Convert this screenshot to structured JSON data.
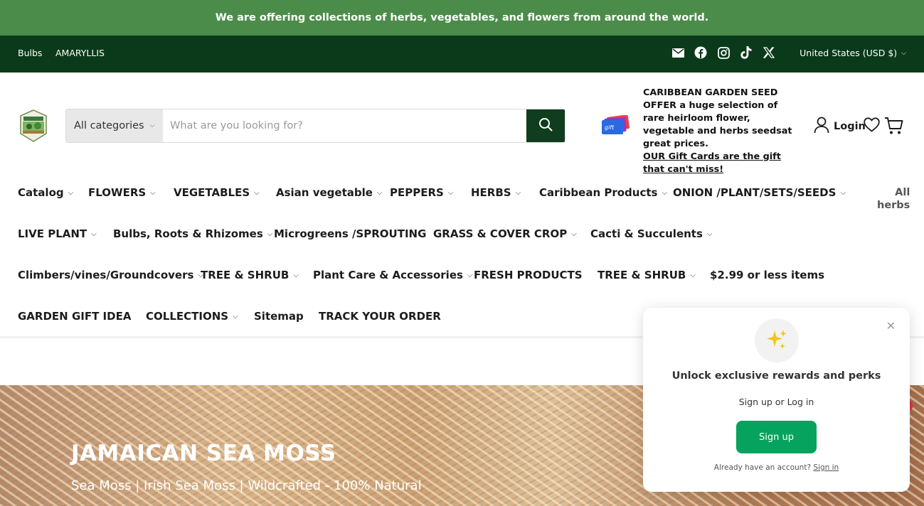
{
  "announcement": "We are offering collections of herbs, vegetables, and flowers from around the world.",
  "utility": {
    "links": [
      "Bulbs",
      "AMARYLLIS"
    ],
    "social_icons": [
      "email-icon",
      "facebook-icon",
      "instagram-icon",
      "tiktok-icon",
      "x-icon"
    ],
    "currency": "United States (USD $)"
  },
  "header": {
    "search": {
      "category": "All categories",
      "placeholder": "What are you looking for?"
    },
    "promo": {
      "text": "CARIBBEAN GARDEN SEED OFFER a huge selection of rare heirloom flower, vegetable and herbs seedsat great prices.",
      "link": "OUR Gift Cards are the gift that can't miss!"
    },
    "login": "Login"
  },
  "nav": {
    "items": [
      {
        "label": "Catalog",
        "dropdown": true
      },
      {
        "label": "FLOWERS",
        "dropdown": true
      },
      {
        "label": "VEGETABLES",
        "dropdown": true
      },
      {
        "label": "Asian vegetable",
        "dropdown": true
      },
      {
        "label": "PEPPERS",
        "dropdown": true
      },
      {
        "label": "HERBS",
        "dropdown": true
      },
      {
        "label": "Caribbean Products",
        "dropdown": true
      },
      {
        "label": "ONION /PLANT/SETS/SEEDS",
        "dropdown": true
      },
      {
        "label": "LIVE PLANT",
        "dropdown": true
      },
      {
        "label": "Bulbs, Roots & Rhizomes",
        "dropdown": true
      },
      {
        "label": "Microgreens /SPROUTING",
        "dropdown": false
      },
      {
        "label": "GRASS & COVER CROP",
        "dropdown": true
      },
      {
        "label": "Cacti & Succulents",
        "dropdown": true
      },
      {
        "label": "Climbers/vines/Groundcovers",
        "dropdown": true
      },
      {
        "label": "TREE & SHRUB",
        "dropdown": true
      },
      {
        "label": "Plant Care & Accessories",
        "dropdown": true
      },
      {
        "label": "FRESH PRODUCTS",
        "dropdown": false
      },
      {
        "label": "TREE & SHRUB",
        "dropdown": true
      },
      {
        "label": "$2.99 or less items",
        "dropdown": false
      },
      {
        "label": "GARDEN GIFT IDEA",
        "dropdown": false
      },
      {
        "label": "COLLECTIONS",
        "dropdown": true
      },
      {
        "label": "Sitemap",
        "dropdown": false
      },
      {
        "label": "TRACK YOUR ORDER",
        "dropdown": false
      }
    ],
    "all_label_1": "All",
    "all_label_2": "herbs"
  },
  "hero": {
    "title": "JAMAICAN SEA MOSS",
    "subtitle": "Sea Moss | Irish Sea Moss | Wildcrafted - 100% Natural"
  },
  "popup": {
    "title": "Unlock exclusive rewards and perks",
    "subtitle": "Sign up or Log in",
    "button": "Sign up",
    "footer_text": "Already have an account?",
    "footer_link": "Sign in"
  },
  "colors": {
    "announcement_bg": "#4c8c4a",
    "utility_bg": "#0a3a1a",
    "search_button": "#0f3d1d",
    "signup_button": "#05a35e"
  }
}
